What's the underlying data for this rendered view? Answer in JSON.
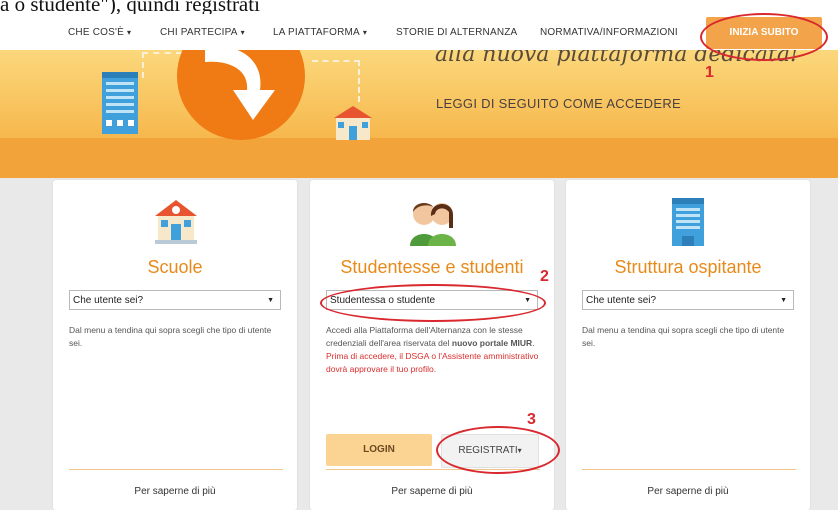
{
  "caption": "a o studente\"), quindi registrati",
  "nav": {
    "items": [
      {
        "label": "CHE COS'È",
        "caret": "▾"
      },
      {
        "label": "CHI PARTECIPA",
        "caret": "▾"
      },
      {
        "label": "LA PIATTAFORMA",
        "caret": "▾"
      },
      {
        "label": "STORIE DI ALTERNANZA",
        "caret": ""
      },
      {
        "label": "NORMATIVA/INFORMAZIONI",
        "caret": ""
      }
    ],
    "cta": "INIZIA SUBITO"
  },
  "hero": {
    "script_text": "alla nuova piattaforma dedicata!",
    "subtitle": "LEGGI DI SEGUITO COME ACCEDERE"
  },
  "annotations": [
    "1",
    "2",
    "3"
  ],
  "cards": [
    {
      "icon": "school-icon",
      "title": "Scuole",
      "select_value": "Che utente sei?",
      "text": "Dal menu a tendina qui sopra scegli che tipo di utente sei.",
      "more": "Per saperne di più"
    },
    {
      "icon": "students-icon",
      "title": "Studentesse e studenti",
      "select_value": "Studentessa o studente",
      "text_a": "Accedi alla Piattaforma dell'Alternanza con le stesse credenziali dell'area riservata del ",
      "text_bold": "nuovo portale MIUR",
      "text_end": ".",
      "text_red": "Prima di accedere, il DSGA o l'Assistente amministrativo dovrà approvare il tuo profilo.",
      "login": "LOGIN",
      "register": "REGISTRATI",
      "more": "Per saperne di più"
    },
    {
      "icon": "building-icon",
      "title": "Struttura ospitante",
      "select_value": "Che utente sei?",
      "text": "Dal menu a tendina qui sopra scegli che tipo di utente sei.",
      "more": "Per saperne di più"
    }
  ],
  "colors": {
    "accent": "#f3a44b",
    "title": "#e88a1a",
    "annotation": "#d9282e"
  }
}
